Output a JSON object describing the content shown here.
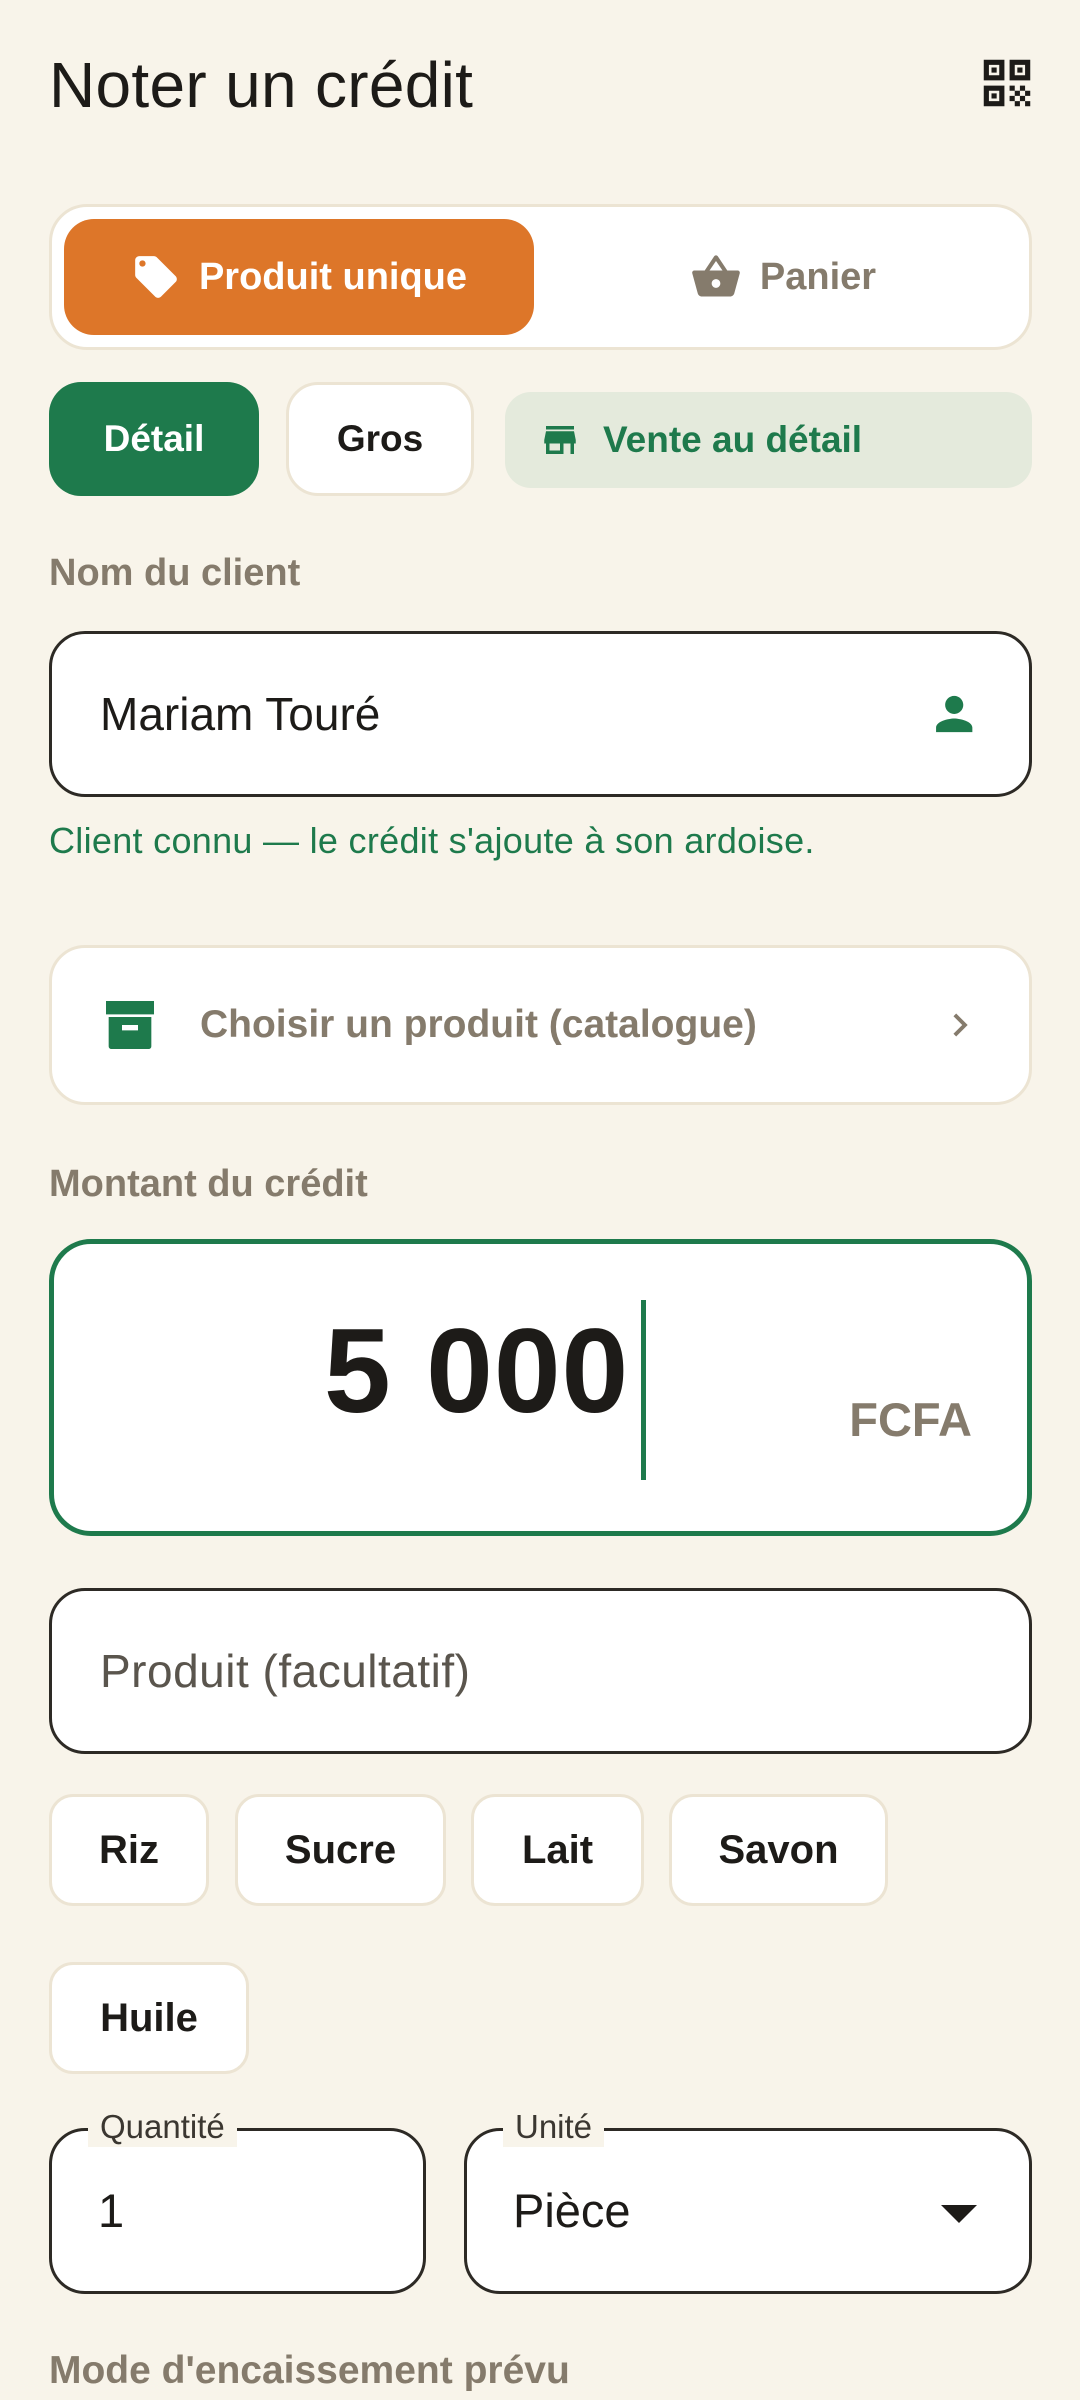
{
  "header": {
    "title": "Noter un crédit",
    "qr_icon": "qr-code-icon"
  },
  "entry_type": {
    "options": [
      {
        "label": "Produit unique",
        "icon": "tag-icon",
        "selected": true
      },
      {
        "label": "Panier",
        "icon": "basket-icon",
        "selected": false
      }
    ]
  },
  "sale_mode": {
    "options": [
      {
        "label": "Détail",
        "selected": true
      },
      {
        "label": "Gros",
        "selected": false
      }
    ],
    "tag": {
      "label": "Vente au détail",
      "icon": "storefront-icon"
    }
  },
  "client": {
    "label": "Nom du client",
    "value": "Mariam Touré",
    "icon": "person-icon",
    "hint": "Client connu — le crédit s'ajoute à son ardoise."
  },
  "catalog": {
    "label": "Choisir un produit (catalogue)",
    "icon": "archive-box-icon"
  },
  "amount": {
    "label": "Montant du crédit",
    "value": "5 000",
    "currency": "FCFA"
  },
  "product": {
    "placeholder": "Produit (facultatif)",
    "suggestions": [
      "Riz",
      "Sucre",
      "Lait",
      "Savon",
      "Huile"
    ]
  },
  "quantity": {
    "label": "Quantité",
    "value": "1"
  },
  "unit": {
    "label": "Unité",
    "value": "Pièce"
  },
  "collection_mode": {
    "label": "Mode d'encaissement prévu"
  },
  "colors": {
    "background": "#f8f4ea",
    "primary_green": "#1e7a4c",
    "accent_orange": "#dd7629",
    "muted_text": "#857b6c",
    "tag_background": "#e4eadc"
  }
}
